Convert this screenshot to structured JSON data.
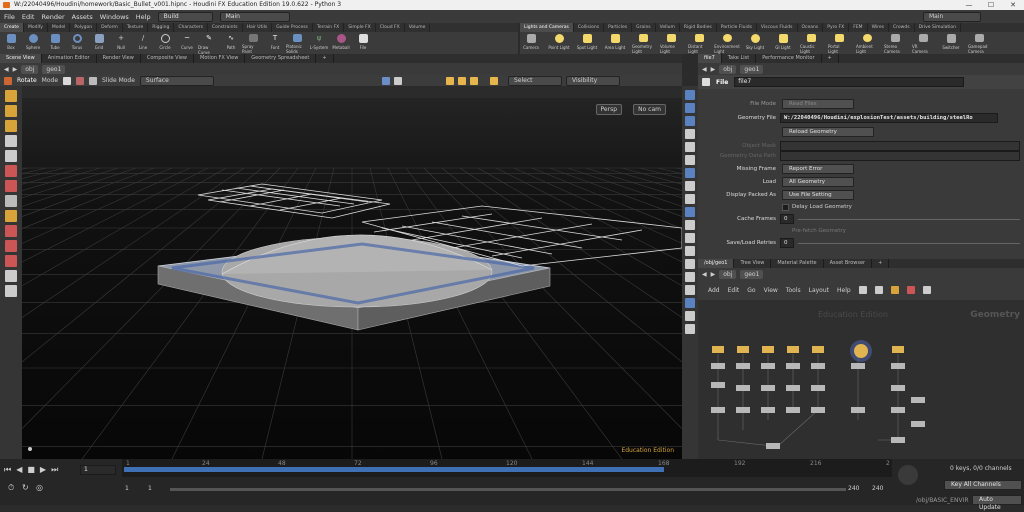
{
  "window": {
    "title": "W:/22040496/Houdini/homework/Basic_Bullet_v001.hipnc - Houdini FX Education Edition 19.0.622 - Python 3",
    "controls": [
      "—",
      "☐",
      "✕"
    ]
  },
  "menubar": {
    "items": [
      "File",
      "Edit",
      "Render",
      "Assets",
      "Windows",
      "Help"
    ],
    "desktop": "Build",
    "desktop_main": "Main",
    "right_desktop": "Main"
  },
  "shelf_left": {
    "tabs": [
      "Create",
      "Modify",
      "Model",
      "Polygon",
      "Deform",
      "Texture",
      "Rigging",
      "Characters",
      "Constraints",
      "Hair Utils",
      "Guide Process",
      "Terrain FX",
      "Simple FX",
      "Cloud FX",
      "Volume"
    ],
    "tools": [
      "Box",
      "Sphere",
      "Tube",
      "Torus",
      "Grid",
      "Null",
      "Line",
      "Circle",
      "Curve",
      "Draw Curve",
      "Path",
      "Spray Paint",
      "Font",
      "Platonic Solids",
      "L-System",
      "Metaball",
      "File"
    ]
  },
  "shelf_right": {
    "tabs": [
      "Lights and Cameras",
      "Collisions",
      "Particles",
      "Grains",
      "Vellum",
      "Rigid Bodies",
      "Particle Fluids",
      "Viscous Fluids",
      "Oceans",
      "Pyro FX",
      "FEM",
      "Wires",
      "Crowds",
      "Drive Simulation"
    ],
    "tools": [
      "Camera",
      "Point Light",
      "Spot Light",
      "Area Light",
      "Geometry Light",
      "Volume Light",
      "Distant Light",
      "Environment Light",
      "Sky Light",
      "GI Light",
      "Caustic Light",
      "Portal Light",
      "Ambient Light",
      "Stereo Camera",
      "VR Camera",
      "Switcher",
      "Gamepad Camera"
    ]
  },
  "left_pane": {
    "tabs": [
      "Scene View",
      "Animation Editor",
      "Render View",
      "Composite View",
      "Motion FX View",
      "Geometry Spreadsheet"
    ],
    "path": [
      "obj",
      "geo1"
    ],
    "toolbar": {
      "tool": "Rotate",
      "mode_label": "Mode",
      "slide_mode": "Slide Mode",
      "surface": "Surface",
      "select": "Select",
      "visibility": "Visibility"
    },
    "viewport": {
      "persp": "Persp",
      "cam": "No cam",
      "watermark": "Education Edition"
    }
  },
  "param_pane": {
    "tabs": [
      "file7",
      "Take List",
      "Performance Monitor"
    ],
    "path": [
      "obj",
      "geo1"
    ],
    "node_type": "File",
    "node_name": "file7",
    "file_mode_label": "File Mode",
    "file_mode": "Read Files",
    "geometry_file_label": "Geometry File",
    "geometry_file": "W:/22040496/Houdini/explosionTest/assets/building/steelRo",
    "reload": "Reload Geometry",
    "object_mask_label": "Object Mask",
    "geo_path_label": "Geometry Data Path",
    "missing_frame_label": "Missing Frame",
    "missing_frame": "Report Error",
    "load_label": "Load",
    "load": "All Geometry",
    "display_packed_label": "Display Packed As",
    "display_packed": "Use File Setting",
    "delay_load": "Delay Load Geometry",
    "cache_frames_label": "Cache Frames",
    "cache_frames": "0",
    "prefetch": "Pre-fetch Geometry",
    "save_load_label": "Save/Load Retries",
    "save_load": "0"
  },
  "network_pane": {
    "tabs": [
      "/obj/geo1",
      "Tree View",
      "Material Palette",
      "Asset Browser"
    ],
    "path": [
      "obj",
      "geo1"
    ],
    "menu": [
      "Add",
      "Edit",
      "Go",
      "View",
      "Tools",
      "Layout",
      "Help"
    ],
    "watermark": "Education Edition",
    "context": "Geometry"
  },
  "timeline": {
    "ticks": [
      "1",
      "24",
      "48",
      "72",
      "96",
      "120",
      "144",
      "168",
      "192",
      "216",
      "2"
    ],
    "frame": "1",
    "start": "1",
    "start2": "1",
    "end": "240",
    "end2": "240",
    "keys": "0 keys, 0/0 channels",
    "key_all": "Key All Channels",
    "obj_path": "/obj/BASIC_ENVIR",
    "auto_update": "Auto Update"
  },
  "colors": {
    "accent_blue": "#3f6fb5",
    "node_yellow": "#e0b450",
    "bg": "#2b2b2b",
    "viewport_bg": "#0c0c0c"
  }
}
